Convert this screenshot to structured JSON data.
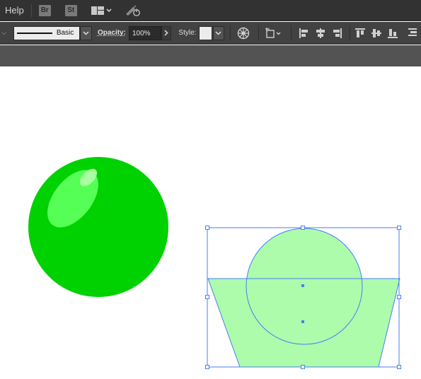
{
  "menubar": {
    "items": [
      "Help"
    ],
    "bridge_label": "Br",
    "stock_label": "St",
    "icons": [
      "workspace-layout-icon",
      "chevron-down-icon",
      "gpu-performance-icon"
    ]
  },
  "controlbar": {
    "stroke_profile": "Basic",
    "opacity_label": "Opacity:",
    "opacity_value": "100%",
    "style_label": "Style:",
    "icons": [
      "recolor-artwork-icon",
      "transform-icon",
      "align-left-icon",
      "align-horizontal-center-icon",
      "align-right-icon",
      "align-top-icon",
      "align-vertical-center-icon",
      "align-bottom-icon",
      "distribute-icon"
    ]
  },
  "colors": {
    "menubar_bg": "#323232",
    "controlbar_bg": "#424242",
    "strip_bg": "#535353",
    "sphere_green": "#00d100",
    "selected_fill": "#acfcac",
    "selection_blue": "#4a7df5"
  },
  "canvas": {
    "objects": [
      "glossy-green-sphere",
      "selected-group-circle-and-trapezoid"
    ]
  }
}
